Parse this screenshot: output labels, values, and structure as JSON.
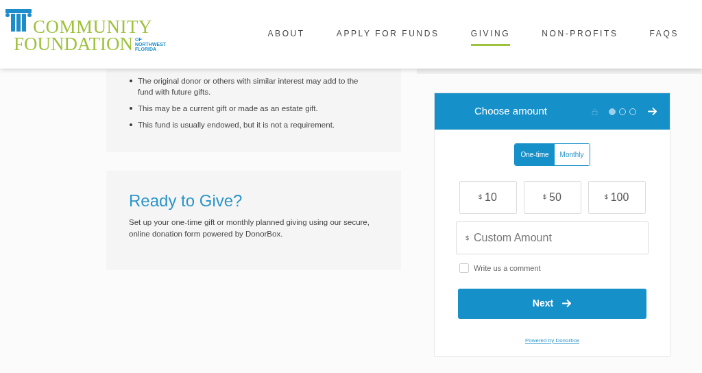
{
  "logo": {
    "line_1": "COMMUNITY",
    "line_2": "FOUNDATION",
    "tagline": [
      "OF",
      "NORTHWEST",
      "FLORIDA"
    ]
  },
  "nav": [
    {
      "label": "ABOUT",
      "selected": false
    },
    {
      "label": "APPLY FOR FUNDS",
      "selected": false
    },
    {
      "label": "GIVING",
      "selected": true
    },
    {
      "label": "NON-PROFITS",
      "selected": false
    },
    {
      "label": "FAQS",
      "selected": false
    }
  ],
  "bullets": [
    "The original donor or others with similar interest may add to the fund with future gifts.",
    "This may be a current gift or made as an estate gift.",
    "This fund is usually endowed, but it is not a requirement."
  ],
  "ready": {
    "title": "Ready to Give?",
    "text": "Set up your one-time gift or monthly planned giving using our secure, online donation form powered by DonorBox."
  },
  "form": {
    "title": "Choose amount",
    "steps": [
      {
        "selected": true
      },
      {
        "selected": false
      },
      {
        "selected": false
      }
    ],
    "frequency": [
      {
        "label": "One-time",
        "selected": true
      },
      {
        "label": "Monthly",
        "selected": false
      }
    ],
    "amounts": [
      {
        "currency": "$",
        "value": "10",
        "selected": false
      },
      {
        "currency": "$",
        "value": "50",
        "selected": false
      },
      {
        "currency": "$",
        "value": "100",
        "selected": false
      }
    ],
    "custom": {
      "currency": "$",
      "placeholder": "Custom Amount"
    },
    "comment": {
      "label": "Write us a comment",
      "checked": false
    },
    "next": "Next",
    "powered": "Powered by Donorbox"
  }
}
